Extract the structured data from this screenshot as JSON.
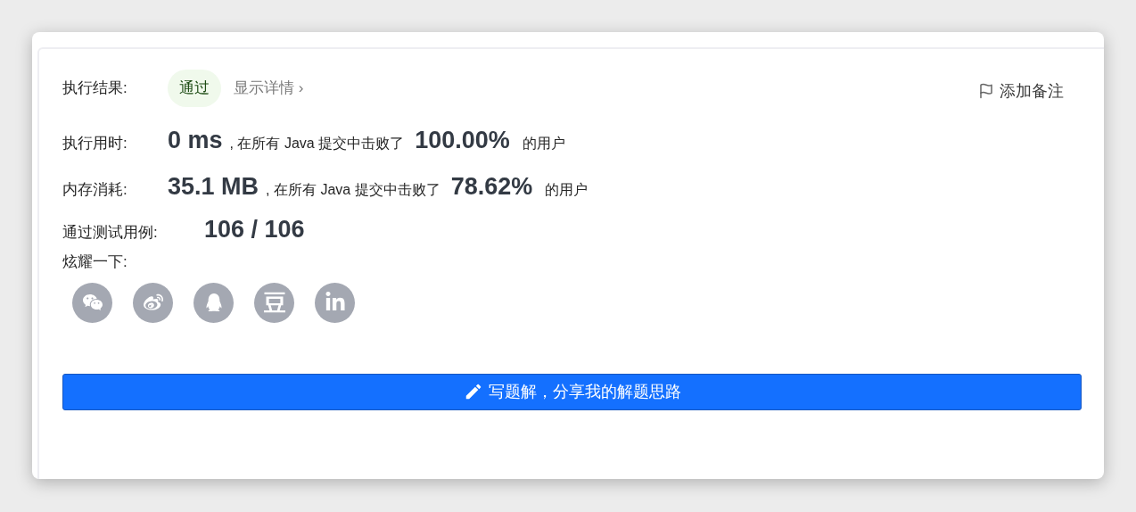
{
  "result": {
    "label": "执行结果:",
    "status": "通过",
    "details_link": "显示详情 ›"
  },
  "note_button": "添加备注",
  "stats": [
    {
      "label": "执行用时:",
      "value": "0 ms",
      "text_before": ", 在所有 Java 提交中击败了",
      "percent": "100.00%",
      "text_after": "的用户"
    },
    {
      "label": "内存消耗:",
      "value": "35.1 MB",
      "text_before": ", 在所有 Java 提交中击败了",
      "percent": "78.62%",
      "text_after": "的用户"
    }
  ],
  "tests": {
    "label": "通过测试用例:",
    "value": "106 / 106"
  },
  "share": {
    "label": "炫耀一下:",
    "icons": [
      {
        "kind": "wechat"
      },
      {
        "kind": "weibo"
      },
      {
        "kind": "qq"
      },
      {
        "kind": "douban"
      },
      {
        "kind": "linkedin"
      }
    ]
  },
  "write_button": "写题解，分享我的解题思路"
}
